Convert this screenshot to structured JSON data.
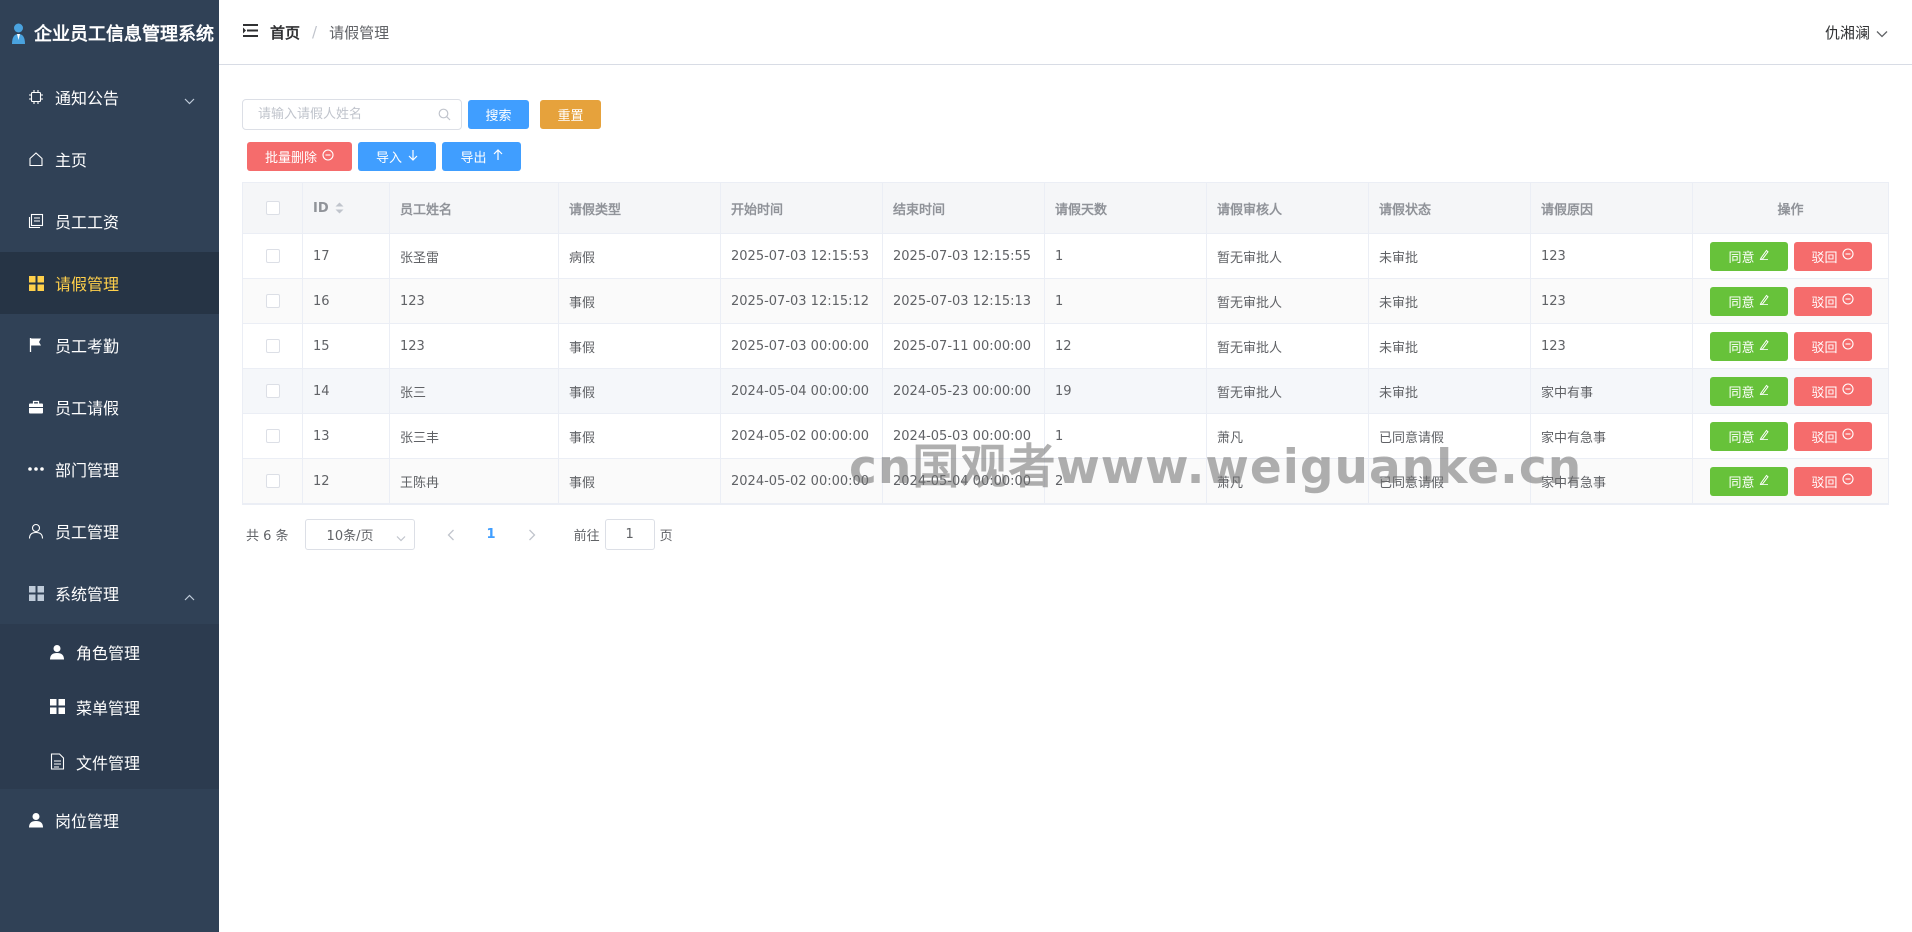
{
  "app": {
    "title": "企业员工信息管理系统"
  },
  "sidebar": {
    "items": [
      {
        "label": "通知公告",
        "icon": "chip-icon",
        "expandable": true,
        "expanded": false
      },
      {
        "label": "主页",
        "icon": "home-icon"
      },
      {
        "label": "员工工资",
        "icon": "document-icon"
      },
      {
        "label": "请假管理",
        "icon": "grid-icon",
        "active": true
      },
      {
        "label": "员工考勤",
        "icon": "flag-icon"
      },
      {
        "label": "员工请假",
        "icon": "briefcase-icon"
      },
      {
        "label": "部门管理",
        "icon": "more-icon"
      },
      {
        "label": "员工管理",
        "icon": "user-icon"
      },
      {
        "label": "系统管理",
        "icon": "grid-icon",
        "expandable": true,
        "expanded": true
      },
      {
        "label": "岗位管理",
        "icon": "user-solid-icon"
      }
    ],
    "submenu": [
      {
        "label": "角色管理",
        "icon": "user-solid-icon"
      },
      {
        "label": "菜单管理",
        "icon": "menu-icon"
      },
      {
        "label": "文件管理",
        "icon": "file-icon"
      }
    ],
    "active_color": "#ffd04b",
    "background": "#304156"
  },
  "header": {
    "breadcrumb": {
      "home": "首页",
      "separator": "/",
      "current": "请假管理"
    },
    "user": "仇湘澜"
  },
  "toolbar": {
    "search_placeholder": "请输入请假人姓名",
    "search_value": "",
    "search_label": "搜索",
    "reset_label": "重置",
    "batch_delete_label": "批量删除",
    "import_label": "导入",
    "export_label": "导出"
  },
  "table": {
    "headers": [
      "ID",
      "员工姓名",
      "请假类型",
      "开始时间",
      "结束时间",
      "请假天数",
      "请假审核人",
      "请假状态",
      "请假原因",
      "操作"
    ],
    "approve_label": "同意",
    "reject_label": "驳回",
    "rows": [
      [
        "17",
        "张圣雷",
        "病假",
        "2025-07-03 12:15:53",
        "2025-07-03 12:15:55",
        "1",
        "暂无审批人",
        "未审批",
        "123"
      ],
      [
        "16",
        "123",
        "事假",
        "2025-07-03 12:15:12",
        "2025-07-03 12:15:13",
        "1",
        "暂无审批人",
        "未审批",
        "123"
      ],
      [
        "15",
        "123",
        "事假",
        "2025-07-03 00:00:00",
        "2025-07-11 00:00:00",
        "12",
        "暂无审批人",
        "未审批",
        "123"
      ],
      [
        "14",
        "张三",
        "事假",
        "2024-05-04 00:00:00",
        "2024-05-23 00:00:00",
        "19",
        "暂无审批人",
        "未审批",
        "家中有事"
      ],
      [
        "13",
        "张三丰",
        "事假",
        "2024-05-02 00:00:00",
        "2024-05-03 00:00:00",
        "1",
        "萧凡",
        "已同意请假",
        "家中有急事"
      ],
      [
        "12",
        "王陈冉",
        "事假",
        "2024-05-02 00:00:00",
        "2024-05-04 00:00:00",
        "2",
        "萧凡",
        "已同意请假",
        "家中有急事"
      ]
    ]
  },
  "pagination": {
    "total_label": "共 6 条",
    "page_size": "10条/页",
    "current_page": "1",
    "goto_label": "前往",
    "goto_value": "1",
    "page_suffix": "页"
  },
  "watermark": "cn国观者www.weiguanke.cn",
  "colors": {
    "primary": "#409eff",
    "warning": "#e6a23c",
    "danger": "#f56c6c",
    "success": "#67c23a"
  }
}
